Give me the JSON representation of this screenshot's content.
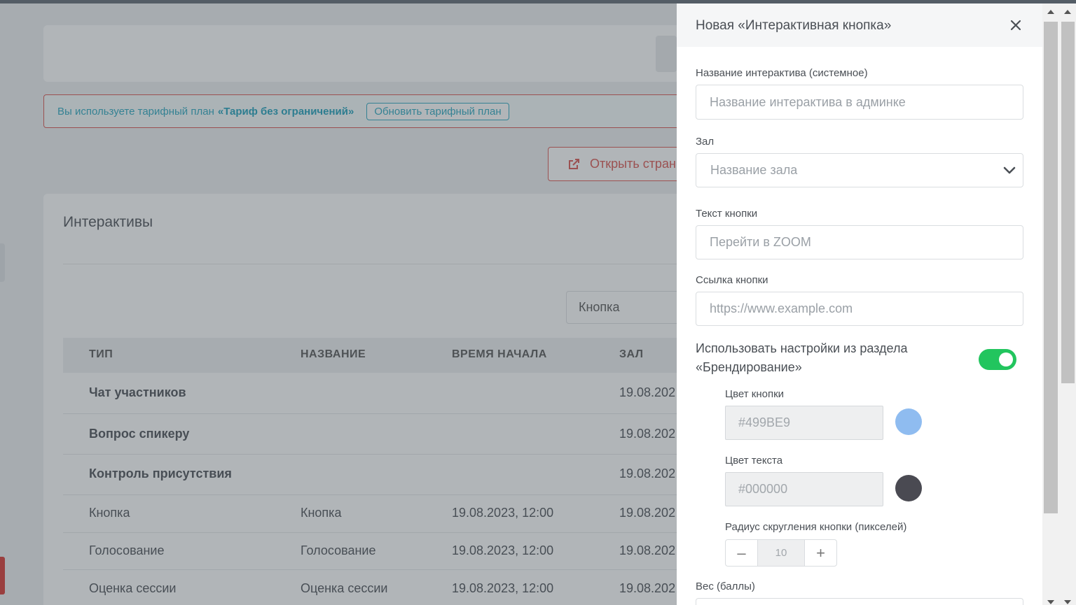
{
  "banner": {
    "text": "Вы используете тарифный план",
    "plan": "«Тариф без ограничений»",
    "upgrade_label": "Обновить тарифный план"
  },
  "open_page_label": "Открыть стран",
  "interactives": {
    "title": "Интерактивы",
    "filter_value": "Кнопка",
    "columns": [
      "ТИП",
      "НАЗВАНИЕ",
      "ВРЕМЯ НАЧАЛА",
      "ЗАЛ"
    ],
    "rows": [
      {
        "type": "Чат участников",
        "name": "",
        "start": "",
        "hall": "19.08.202"
      },
      {
        "type": "Вопрос спикеру",
        "name": "",
        "start": "",
        "hall": "19.08.202"
      },
      {
        "type": "Контроль присутствия",
        "name": "",
        "start": "",
        "hall": "19.08.202"
      },
      {
        "type": "Кнопка",
        "name": "Кнопка",
        "start": "19.08.2023, 12:00",
        "hall": "19.08.202"
      },
      {
        "type": "Голосование",
        "name": "Голосование",
        "start": "19.08.2023, 12:00",
        "hall": "19.08.202"
      },
      {
        "type": "Оценка сессии",
        "name": "Оценка сессии",
        "start": "19.08.2023, 12:00",
        "hall": "19.08.202"
      }
    ]
  },
  "panel": {
    "title": "Новая «Интерактивная кнопка»",
    "name_label": "Название интерактива (системное)",
    "name_placeholder": "Название интерактива в админке",
    "hall_label": "Зал",
    "hall_placeholder": "Название зала",
    "button_text_label": "Текст кнопки",
    "button_text_placeholder": "Перейти в ZOOM",
    "link_label": "Ссылка кнопки",
    "link_placeholder": "https://www.example.com",
    "branding_toggle_label": "Использовать настройки из раздела «Брендирование»",
    "branding_toggle_on": true,
    "button_color_label": "Цвет кнопки",
    "button_color_value": "#499BE9",
    "text_color_label": "Цвет текста",
    "text_color_value": "#000000",
    "radius_label": "Радиус скругления кнопки (пикселей)",
    "radius_value": "10",
    "radius_minus": "–",
    "radius_plus": "+",
    "weight_label": "Вес (баллы)"
  },
  "colors": {
    "accent_red": "#d9534f",
    "accent_teal": "#2aa7c0",
    "toggle_green": "#22c55e",
    "swatch_button": "#8fbcf0",
    "swatch_text": "#4a4a52"
  }
}
